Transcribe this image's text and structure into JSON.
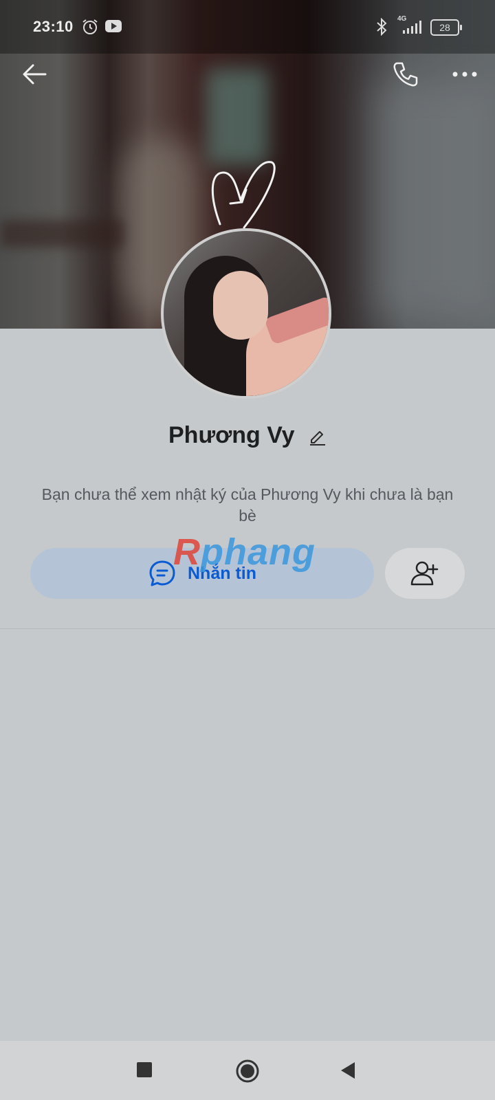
{
  "status_bar": {
    "time": "23:10",
    "network": "4G",
    "battery": "28",
    "icons": [
      "alarm-icon",
      "youtube-icon",
      "bluetooth-icon",
      "signal-icon",
      "battery-icon"
    ]
  },
  "top_nav": {
    "icons": [
      "back-arrow-icon",
      "phone-call-icon",
      "more-options-icon"
    ]
  },
  "profile": {
    "name": "Phương Vy",
    "notice": "Bạn chưa thể xem nhật ký của Phương Vy khi chưa là bạn bè"
  },
  "actions": {
    "message_label": "Nhắn tin",
    "message_icon": "chat-bubble-icon",
    "add_friend_icon": "add-friend-icon"
  },
  "watermark": {
    "first": "R",
    "rest": "phang"
  },
  "colors": {
    "background": "#c6c9cb",
    "message_button_bg": "#b4c4d6",
    "message_text": "#0a5ad2",
    "name_text": "#1e1f21"
  },
  "system_nav": {
    "icons": [
      "recent-apps-icon",
      "home-icon",
      "back-icon"
    ]
  }
}
